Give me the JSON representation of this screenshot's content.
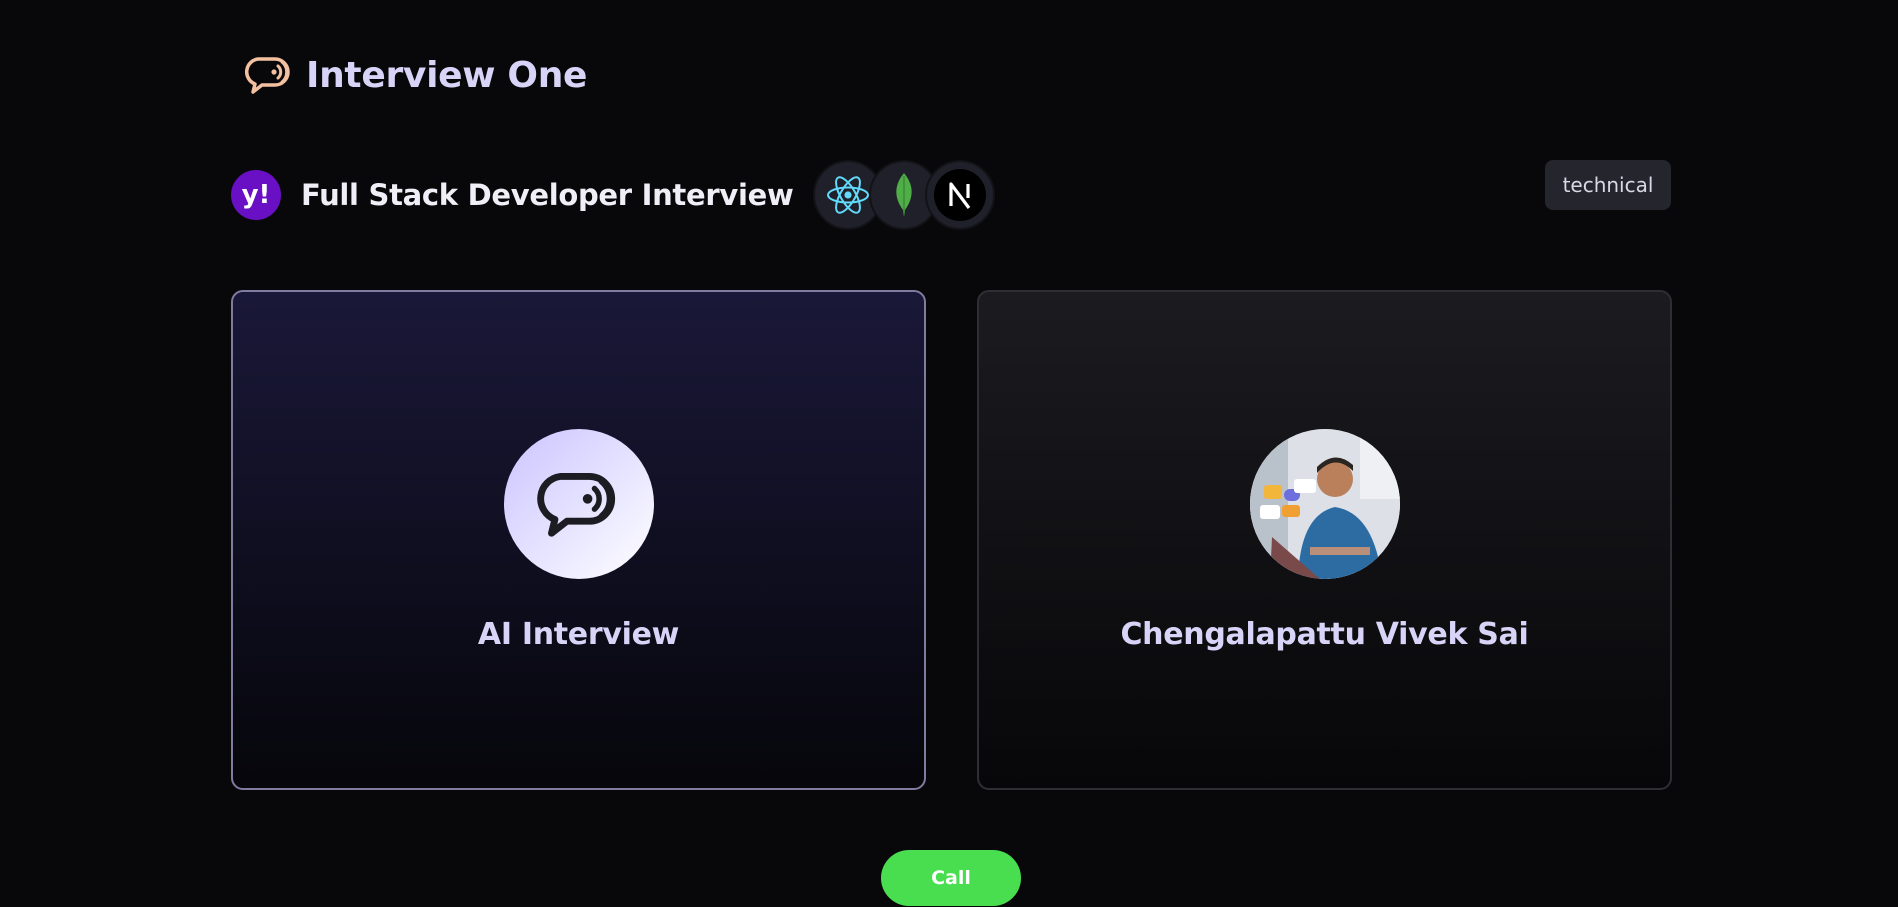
{
  "app": {
    "title": "Interview One",
    "logo_icon": "chat-bubble-voice-icon",
    "accent": "#f5c4a0"
  },
  "interview": {
    "company_logo_text": "y!",
    "company_logo_color": "#6a10c4",
    "title": "Full Stack Developer Interview",
    "tech_stack": [
      "react-icon",
      "mongodb-icon",
      "nextjs-icon"
    ],
    "type": "technical"
  },
  "cards": {
    "ai": {
      "label": "AI Interview",
      "avatar_icon": "chat-bubble-voice-icon"
    },
    "user": {
      "label": "Chengalapattu Vivek Sai",
      "avatar": "user-photo"
    }
  },
  "call": {
    "label": "Call",
    "color": "#49de50"
  }
}
